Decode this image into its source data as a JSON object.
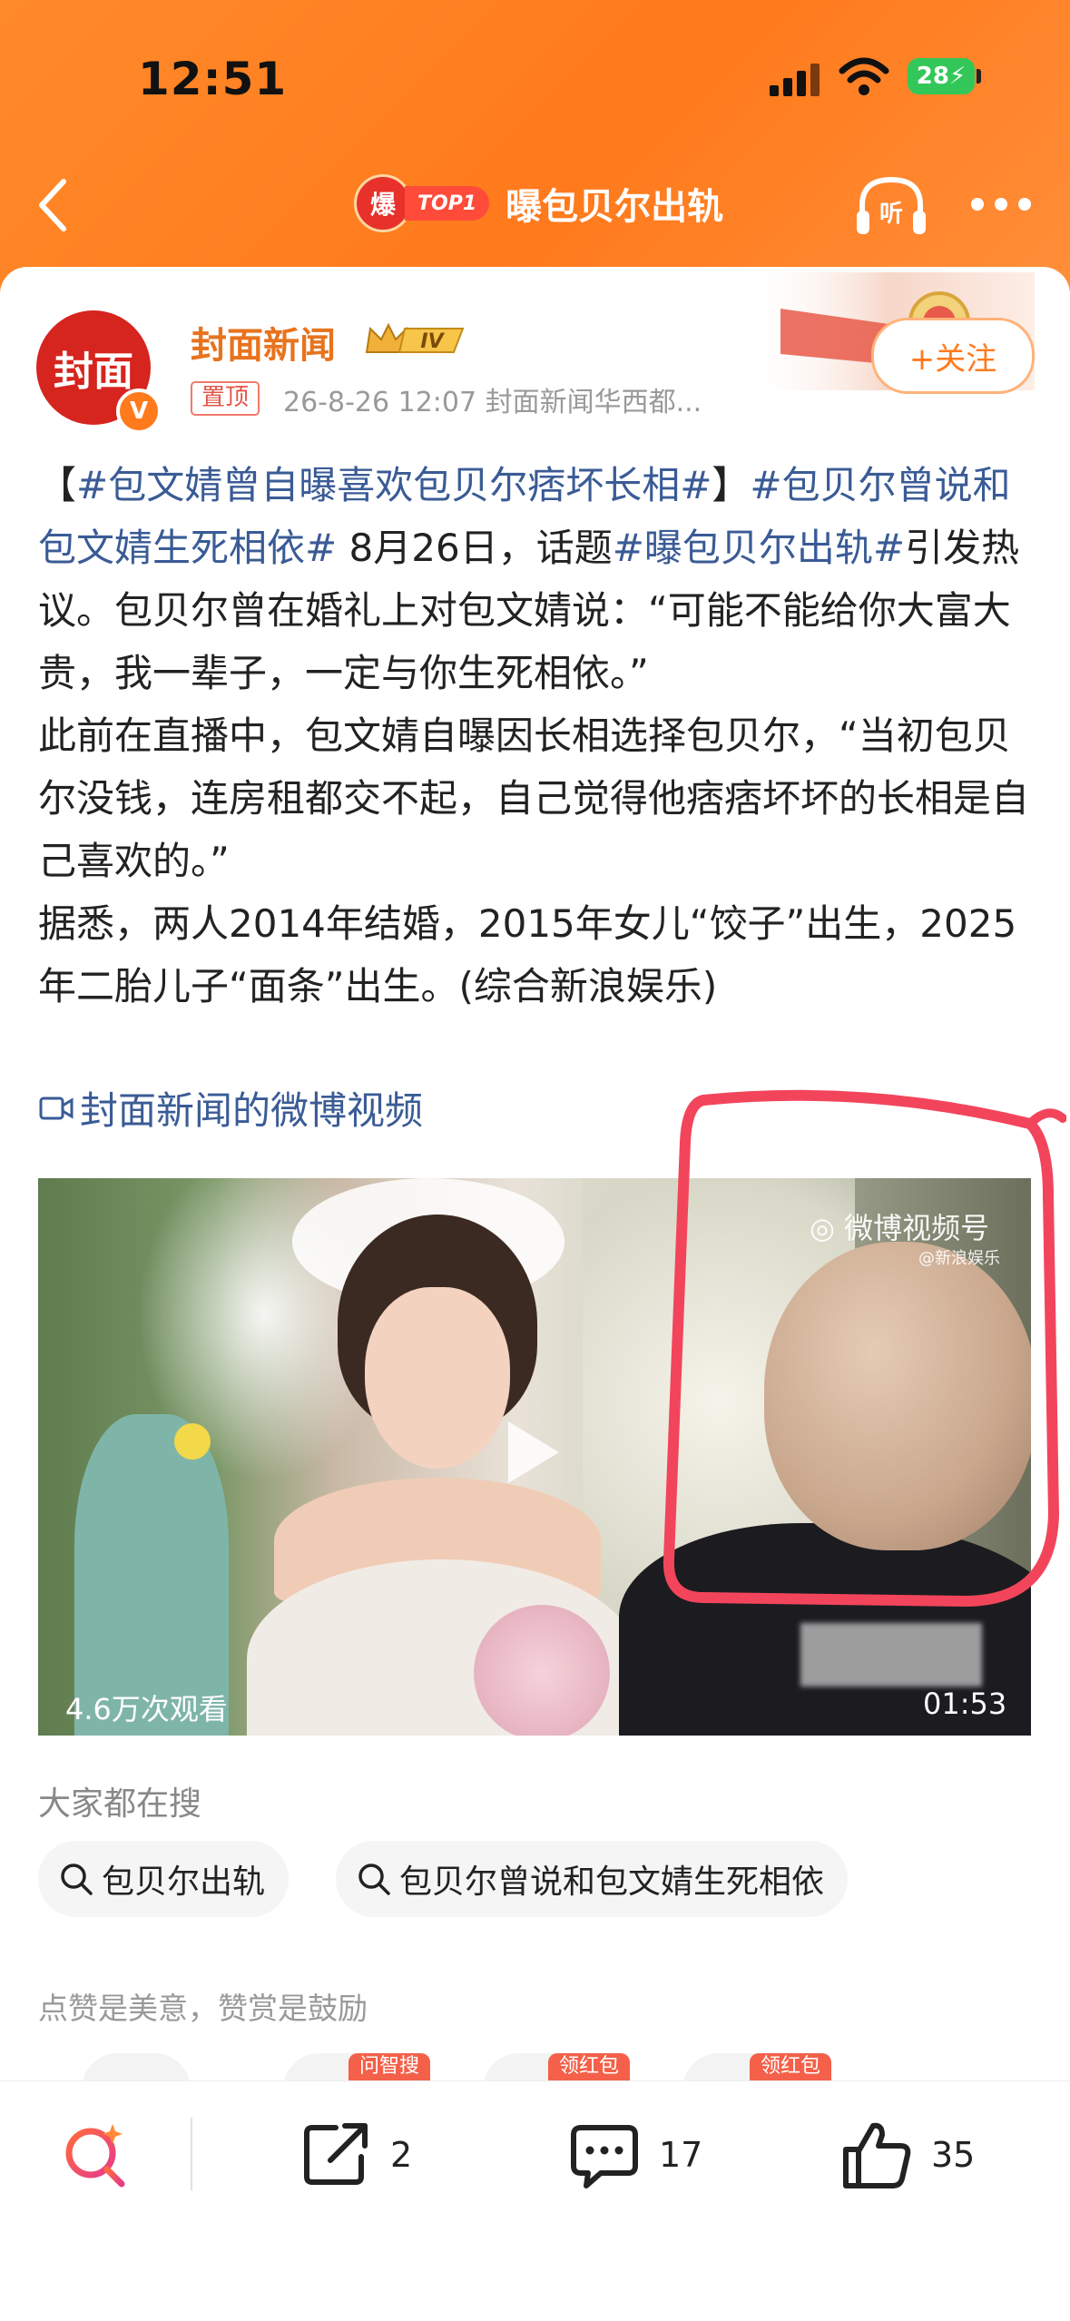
{
  "status_bar": {
    "time": "12:51",
    "battery": "28"
  },
  "header": {
    "hot_icon": "爆",
    "rank_badge": "TOP1",
    "title": "曝包贝尔出轨",
    "icons": [
      "back-icon",
      "listen-icon",
      "more-icon"
    ]
  },
  "author": {
    "avatar_text": "封面",
    "verified_badge": "V",
    "name": "封面新闻",
    "level": "IV",
    "pinned_label": "置顶",
    "meta": "26-8-26 12:07  封面新闻华西都...",
    "follow_label": "+关注"
  },
  "post": {
    "segments": [
      {
        "text": "【",
        "tag": false
      },
      {
        "text": "#包文婧曾自曝喜欢包贝尔痞坏长相#",
        "tag": true
      },
      {
        "text": "】",
        "tag": false
      },
      {
        "text": "#包贝尔曾说和包文婧生死相依#",
        "tag": true
      },
      {
        "text": " 8月26日，话题",
        "tag": false
      },
      {
        "text": "#曝包贝尔出轨#",
        "tag": true
      },
      {
        "text": "引发热议。包贝尔曾在婚礼上对包文婧说：“可能不能给你大富大贵，我一辈子，一定与你生死相依。”",
        "tag": false
      }
    ],
    "para2": "此前在直播中，包文婧自曝因长相选择包贝尔，“当初包贝尔没钱，连房租都交不起，自己觉得他痞痞坏坏的长相是自己喜欢的。”",
    "para3": "据悉，两人2014年结婚，2015年女儿“饺子”出生，2025年二胎儿子“面条”出生。(综合新浪娱乐)",
    "video_link": "封面新闻的微博视频"
  },
  "video": {
    "views": "4.6万次观看",
    "duration": "01:53",
    "watermark": "微博视频号",
    "watermark_sub": "@新浪娱乐",
    "annotation_color": "#f2455c"
  },
  "search": {
    "title": "大家都在搜",
    "chips": [
      "包贝尔出轨",
      "包贝尔曾说和包文婧生死相依"
    ]
  },
  "like_slogan": "点赞是美意，赞赏是鼓励",
  "reward_tags": [
    "问智搜",
    "领红包",
    "领红包"
  ],
  "bottom_bar": {
    "repost_count": "2",
    "comment_count": "17",
    "like_count": "35"
  },
  "colors": {
    "brand_orange": "#ff7a1c",
    "tag_blue": "#3a5b96"
  }
}
